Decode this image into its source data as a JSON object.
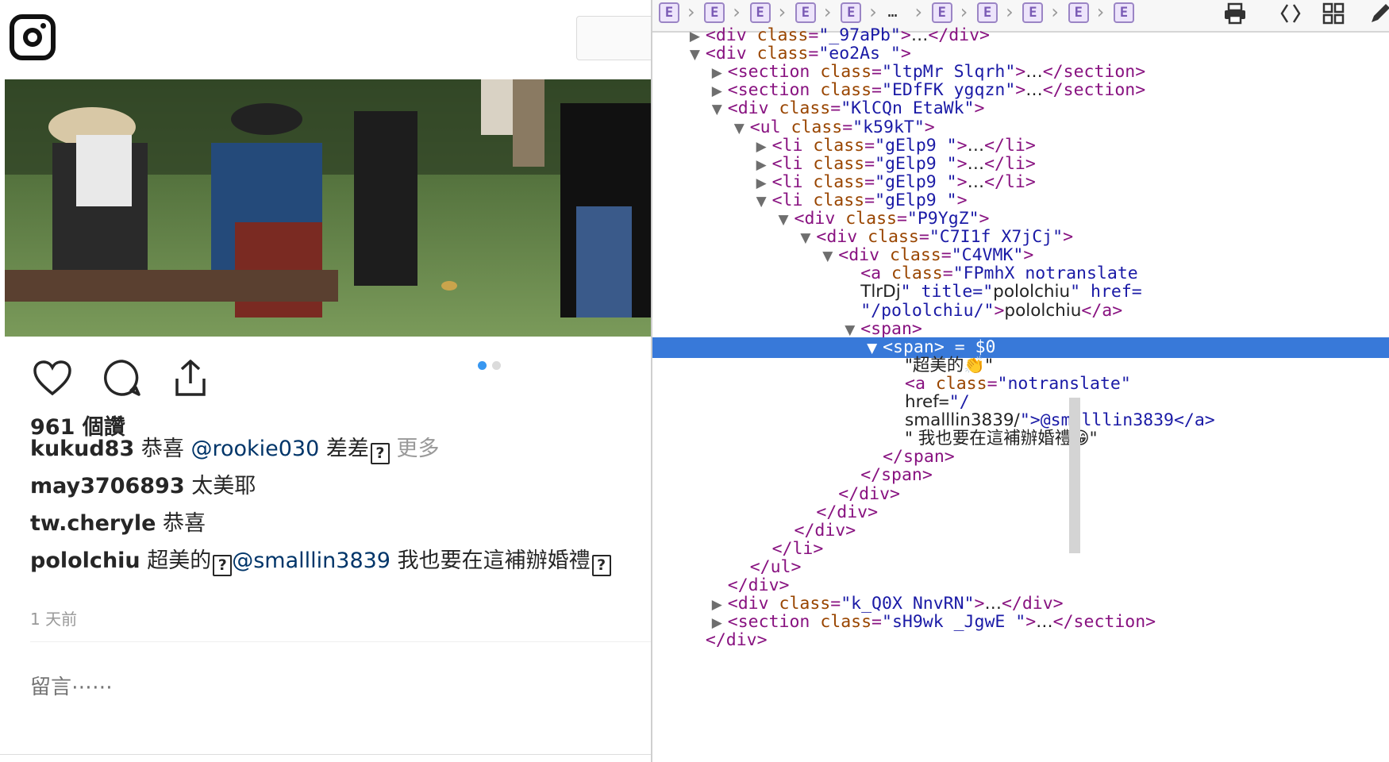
{
  "instagram": {
    "likes": "961 個讚",
    "comments": [
      {
        "user": "kukud83",
        "text": " 恭喜 ",
        "mention": "@rookie030",
        "text2": " 差差",
        "tofu": true,
        "more": " 更多"
      },
      {
        "user": "may3706893",
        "text": " 太美耶"
      },
      {
        "user": "tw.cheryle",
        "text": " 恭喜"
      },
      {
        "user": "pololchiu",
        "text": " 超美的",
        "tofu_mid": true,
        "mention": "@smalllin3839",
        "text2": " 我也要在這補辦婚禮",
        "tofu": true
      }
    ],
    "timestamp": "1 天前",
    "comment_placeholder": "留言⋯⋯",
    "carousel": {
      "total": 2,
      "active": 1
    }
  },
  "devtools": {
    "breadcrumbs": [
      "E",
      "E",
      "E",
      "E",
      "E",
      "…",
      "E",
      "E",
      "E",
      "E",
      "E"
    ],
    "tools": [
      "print-icon",
      "code-brackets-icon",
      "grid-icon",
      "pen-icon"
    ],
    "tree": [
      {
        "expanded": false,
        "tag": "div",
        "attrs": [
          [
            "class",
            "_97aPb"
          ]
        ],
        "collapsed": true,
        "partial": true
      },
      {
        "expanded": true,
        "tag": "div",
        "attrs": [
          [
            "class",
            "eo2As "
          ]
        ]
      },
      {
        "expanded": false,
        "tag": "section",
        "attrs": [
          [
            "class",
            "ltpMr Slqrh"
          ]
        ],
        "collapsed": true
      },
      {
        "expanded": false,
        "tag": "section",
        "attrs": [
          [
            "class",
            "EDfFK ygqzn"
          ]
        ],
        "collapsed": true
      },
      {
        "expanded": true,
        "tag": "div",
        "attrs": [
          [
            "class",
            "KlCQn EtaWk"
          ]
        ]
      },
      {
        "expanded": true,
        "tag": "ul",
        "attrs": [
          [
            "class",
            "k59kT"
          ]
        ]
      },
      {
        "expanded": false,
        "tag": "li",
        "attrs": [
          [
            "class",
            "gElp9 "
          ]
        ],
        "collapsed": true
      },
      {
        "expanded": false,
        "tag": "li",
        "attrs": [
          [
            "class",
            "gElp9 "
          ]
        ],
        "collapsed": true
      },
      {
        "expanded": false,
        "tag": "li",
        "attrs": [
          [
            "class",
            "gElp9 "
          ]
        ],
        "collapsed": true
      },
      {
        "expanded": true,
        "tag": "li",
        "attrs": [
          [
            "class",
            "gElp9 "
          ]
        ]
      },
      {
        "expanded": true,
        "tag": "div",
        "attrs": [
          [
            "class",
            "P9YgZ"
          ]
        ]
      },
      {
        "expanded": true,
        "tag": "div",
        "attrs": [
          [
            "class",
            "C7I1f X7jCj"
          ]
        ]
      },
      {
        "expanded": true,
        "tag": "div",
        "attrs": [
          [
            "class",
            "C4VMK"
          ]
        ]
      },
      {
        "raw_line1": "<a class=\"FPmhX notranslate",
        "raw_line2": "TlrDj\" title=\"pololchiu\" href=",
        "raw_line3": "\"/pololchiu/\">pololchiu</a>"
      },
      {
        "expanded": true,
        "tag": "span",
        "attrs": []
      },
      {
        "expanded": true,
        "tag": "span",
        "attrs": [],
        "selected": true,
        "suffix": " = $0"
      },
      {
        "text_node": "\"超美的👏\""
      },
      {
        "raw": "<a class=\"notranslate\""
      },
      {
        "raw": "href=\"/"
      },
      {
        "raw": "smalllin3839/\">@smalllin3839</a>"
      },
      {
        "text_node": "\" 我也要在這補辦婚禮😁\""
      },
      {
        "close": "span"
      },
      {
        "close": "span"
      },
      {
        "close": "div"
      },
      {
        "close": "div"
      },
      {
        "close": "div"
      },
      {
        "close": "li"
      },
      {
        "close": "ul"
      },
      {
        "close": "div"
      },
      {
        "expanded": false,
        "tag": "div",
        "attrs": [
          [
            "class",
            "k_Q0X NnvRN"
          ]
        ],
        "collapsed": true
      },
      {
        "expanded": false,
        "tag": "section",
        "attrs": [
          [
            "class",
            "sH9wk _JgwE "
          ]
        ],
        "collapsed": true
      },
      {
        "close": "div"
      }
    ]
  },
  "colors": {
    "selection": "#3879d9",
    "tag": "#881280",
    "attr": "#994500",
    "value": "#1a1aa6",
    "mention": "#003569",
    "dot_active": "#3897f0"
  }
}
